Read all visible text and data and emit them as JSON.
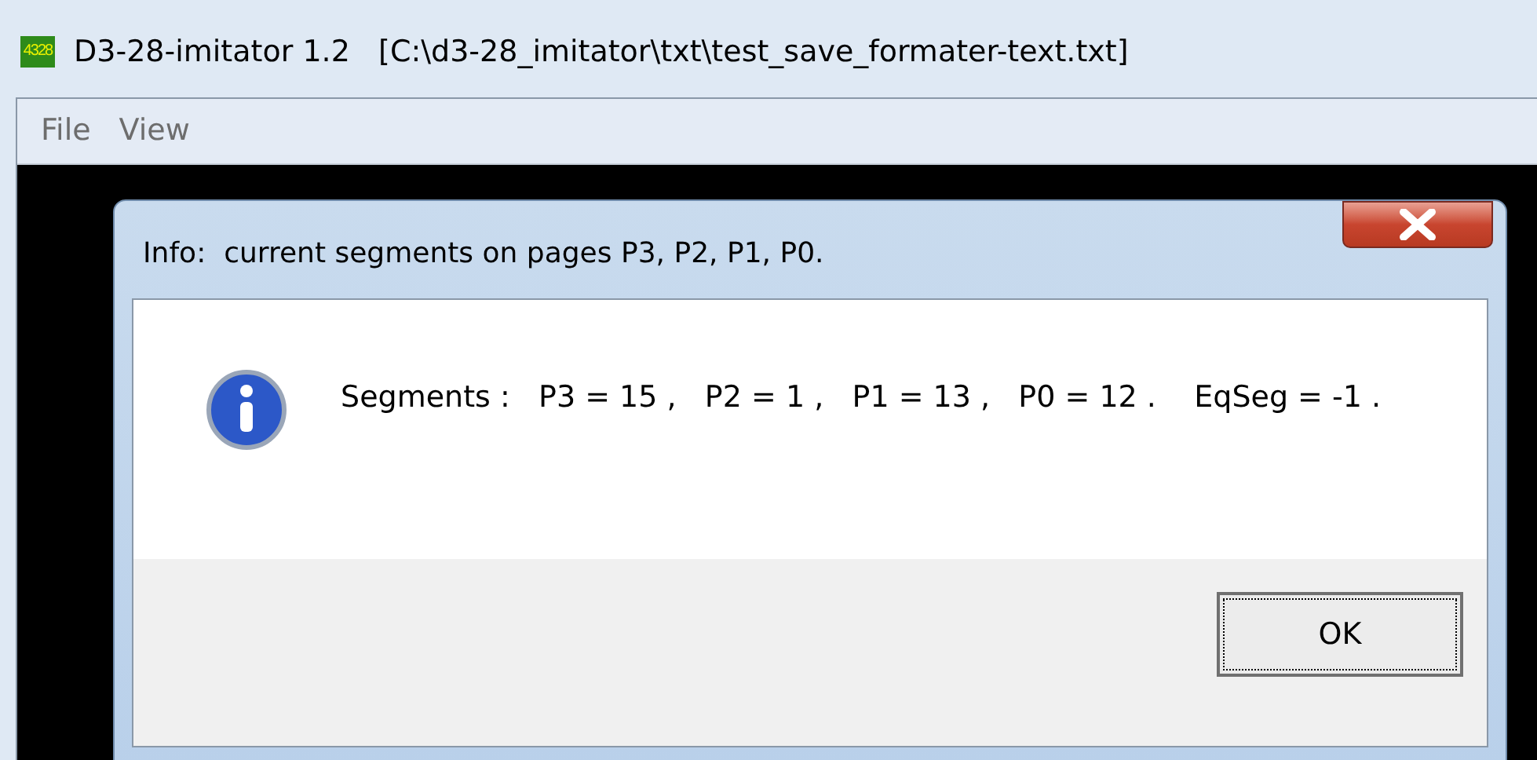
{
  "window": {
    "title": "D3-28-imitator 1.2   [C:\\d3-28_imitator\\txt\\test_save_formater-text.txt]",
    "app_icon_text": "4328"
  },
  "menu": [
    {
      "label": "File"
    },
    {
      "label": "View"
    }
  ],
  "dialog": {
    "title": "Info:  current segments on pages P3, P2, P1, P0.",
    "message": " Segments :   P3 = 15 ,   P2 = 1 ,   P1 = 13 ,   P0 = 12 .    EqSeg = -1 .",
    "buttons": [
      {
        "label": "OK",
        "focused": true
      }
    ]
  }
}
